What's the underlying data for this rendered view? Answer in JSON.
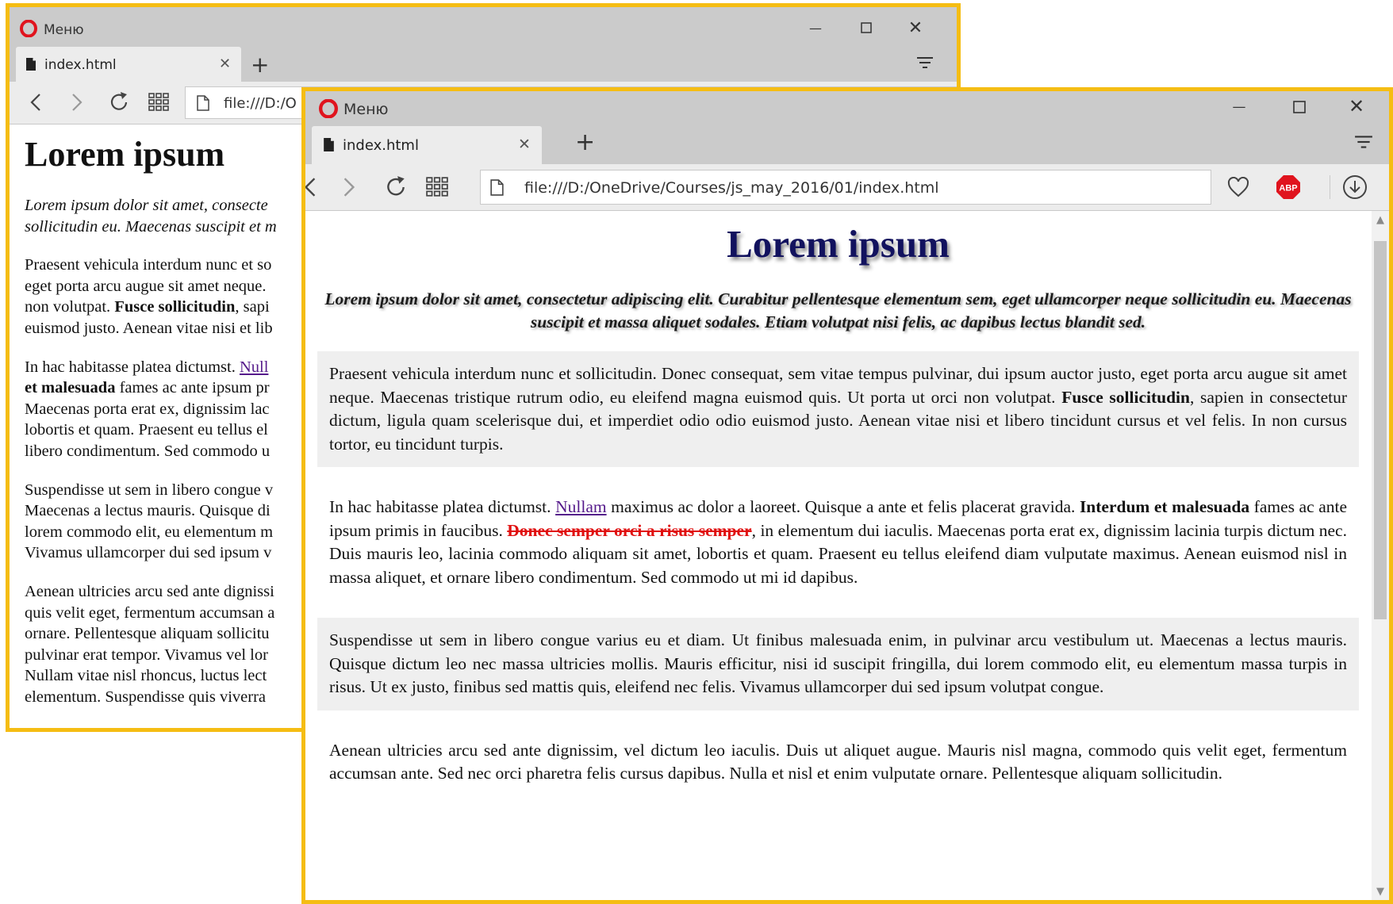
{
  "browser": {
    "menu_label": "Меню",
    "tab_title": "index.html",
    "close_tab_glyph": "✕",
    "new_tab_glyph": "+",
    "minimize_glyph": "—",
    "maximize_glyph": "☐",
    "close_glyph": "✕",
    "accent_color": "#f5bd13",
    "titlebar_color": "#cbcbcb",
    "toolbar_color": "#ececec"
  },
  "window_back": {
    "address_visible": "file:///D:/O",
    "page": {
      "title": "Lorem ipsum",
      "lead_lines": [
        "Lorem ipsum dolor sit amet, consecte",
        "sollicitudin eu. Maecenas suscipit et m"
      ],
      "p1_lines": [
        "Praesent vehicula interdum nunc et so",
        "eget porta arcu augue sit amet neque.",
        "non volutpat.",
        "Fusce sollicitudin",
        ", sapi",
        "euismod justo. Aenean vitae nisi et lib"
      ],
      "p2": {
        "l1_text": "In hac habitasse platea dictumst. ",
        "l1_link": "Null",
        "l2_bold": "et malesuada",
        "l2_text": " fames ac ante ipsum pr",
        "l3": "Maecenas porta erat ex, dignissim lac",
        "l4": "lobortis et quam. Praesent eu tellus el",
        "l5": "libero condimentum. Sed commodo u"
      },
      "p3_lines": [
        "Suspendisse ut sem in libero congue v",
        "Maecenas a lectus mauris. Quisque di",
        "lorem commodo elit, eu elementum m",
        "Vivamus ullamcorper dui sed ipsum v"
      ],
      "p4_lines": [
        "Aenean ultricies arcu sed ante dignissi",
        "quis velit eget, fermentum accumsan a",
        "ornare. Pellentesque aliquam sollicitu",
        "pulvinar erat tempor. Vivamus vel lor",
        "Nullam vitae nisl rhoncus, luctus lect",
        "elementum. Suspendisse quis viverra"
      ]
    }
  },
  "window_front": {
    "address": "file:///D:/OneDrive/Courses/js_may_2016/01/index.html",
    "adblock_label": "ABP",
    "page": {
      "title": "Lorem ipsum",
      "lead": "Lorem ipsum dolor sit amet, consectetur adipiscing elit. Curabitur pellentesque elementum sem, eget ullamcorper neque sollicitudin eu. Maecenas suscipit et massa aliquet sodales. Etiam volutpat nisi felis, ac dapibus lectus blandit sed.",
      "p1": {
        "a": "Praesent vehicula interdum nunc et sollicitudin. Donec consequat, sem vitae tempus pulvinar, dui ipsum auctor justo, eget porta arcu augue sit amet neque. Maecenas tristique rutrum odio, eu eleifend magna euismod quis. Ut porta ut orci non volutpat. ",
        "bold": "Fusce sollicitudin",
        "b": ", sapien in consectetur dictum, ligula quam scelerisque dui, et imperdiet odio odio euismod justo. Aenean vitae nisi et libero tincidunt cursus et vel felis. In non cursus tortor, eu tincidunt turpis."
      },
      "p2": {
        "a": "In hac habitasse platea dictumst. ",
        "link": "Nullam",
        "b": " maximus ac dolor a laoreet. Quisque a ante et felis placerat gravida. ",
        "bold": "Interdum et malesuada",
        "c": " fames ac ante ipsum primis in faucibus. ",
        "strike": "Donec semper orci a risus semper",
        "d": ", in elementum dui iaculis. Maecenas porta erat ex, dignissim lacinia turpis dictum nec. Duis mauris leo, lacinia commodo aliquam sit amet, lobortis et quam. Praesent eu tellus eleifend diam vulputate maximus. Aenean euismod nisl in massa aliquet, et ornare libero condimentum. Sed commodo ut mi id dapibus."
      },
      "p3": "Suspendisse ut sem in libero congue varius eu et diam. Ut finibus malesuada enim, in pulvinar arcu vestibulum ut. Maecenas a lectus mauris. Quisque dictum leo nec massa ultricies mollis. Mauris efficitur, nisi id suscipit fringilla, dui lorem commodo elit, eu elementum massa turpis in risus. Ut ex justo, finibus sed mattis quis, eleifend nec felis. Vivamus ullamcorper dui sed ipsum volutpat congue.",
      "p4": "Aenean ultricies arcu sed ante dignissim, vel dictum leo iaculis. Duis ut aliquet augue. Mauris nisl magna, commodo quis velit eget, fermentum accumsan ante. Sed nec orci pharetra felis cursus dapibus. Nulla et nisl et enim vulputate ornare. Pellentesque aliquam sollicitudin."
    }
  }
}
